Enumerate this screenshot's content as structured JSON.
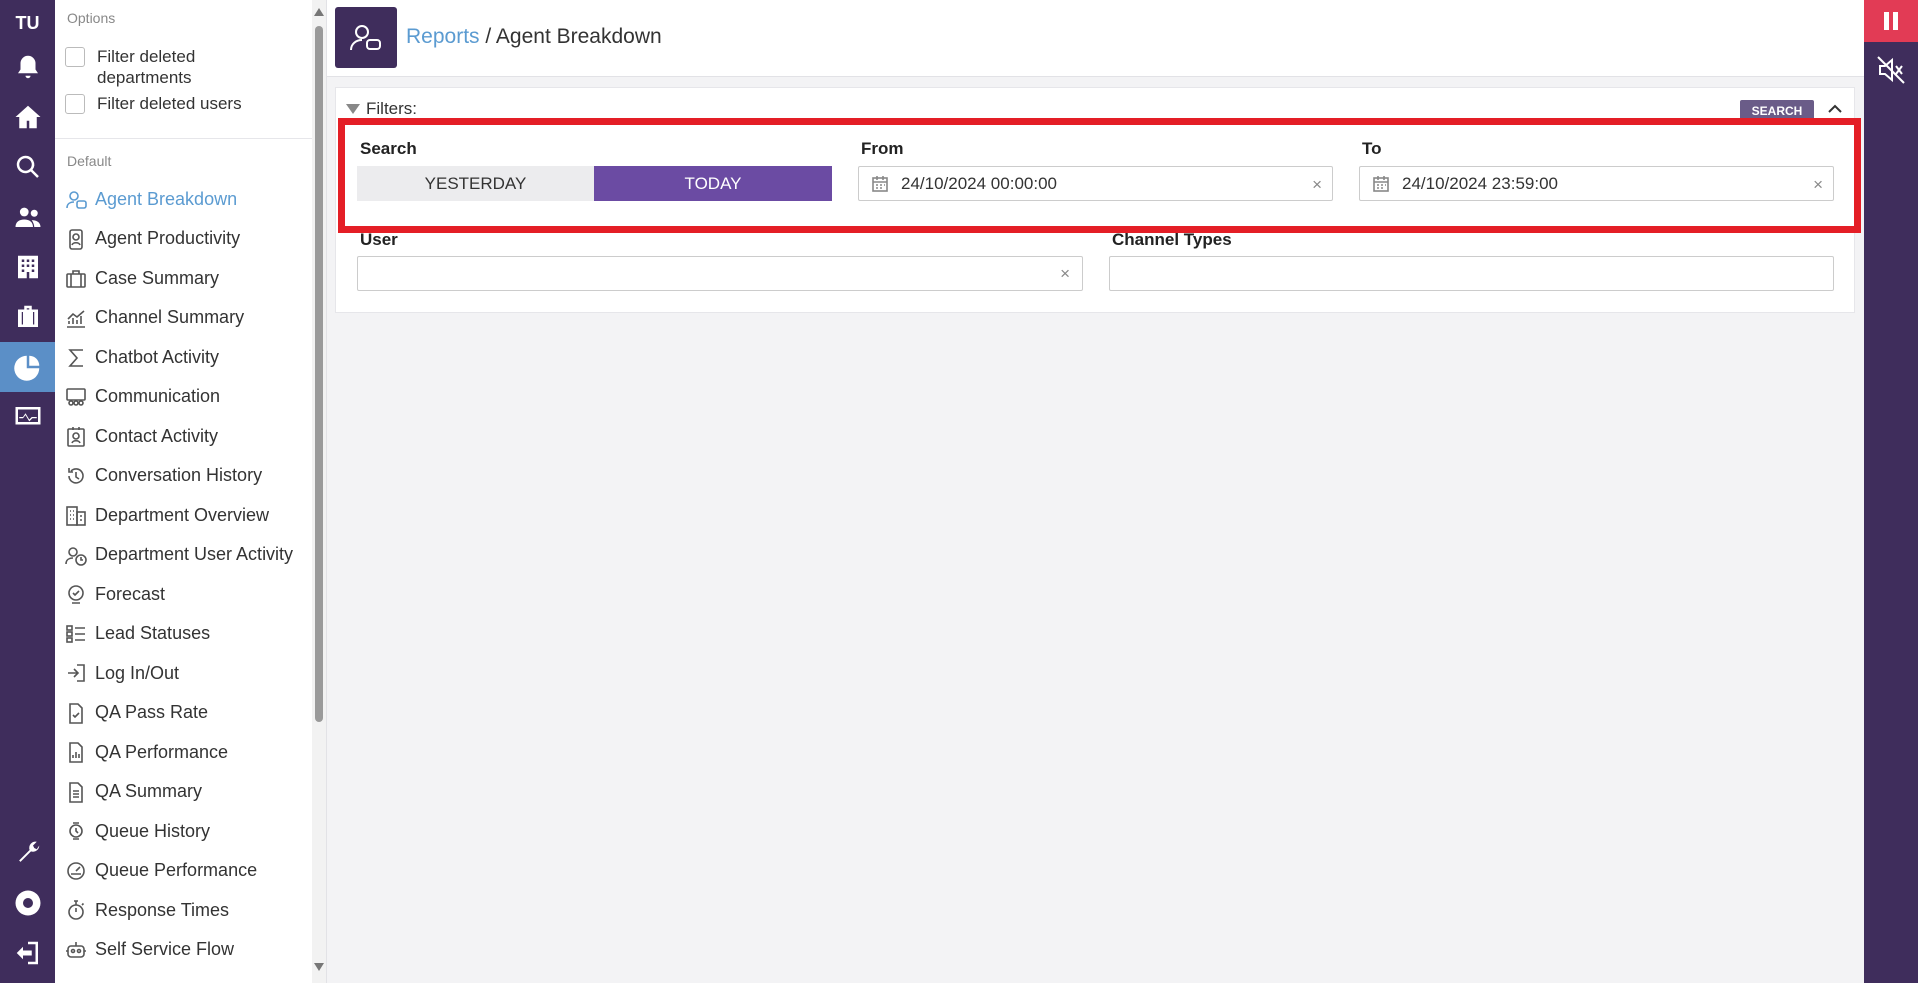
{
  "rail": {
    "brand": "TU",
    "icons": [
      "bell-icon",
      "home-icon",
      "search-icon",
      "users-icon",
      "building-icon",
      "briefcase-icon",
      "pie-chart-icon",
      "monitor-icon",
      "wrench-icon",
      "lifebuoy-icon",
      "logout-icon"
    ],
    "active": "pie-chart-icon"
  },
  "menu": {
    "options_label": "Options",
    "options": [
      {
        "label": "Filter deleted departments",
        "checked": false
      },
      {
        "label": "Filter deleted users",
        "checked": false
      }
    ],
    "default_label": "Default",
    "items": [
      {
        "label": "Agent Breakdown",
        "icon": "user-chat-icon",
        "active": true
      },
      {
        "label": "Agent Productivity",
        "icon": "badge-icon",
        "active": false
      },
      {
        "label": "Case Summary",
        "icon": "briefcase-icon",
        "active": false
      },
      {
        "label": "Channel Summary",
        "icon": "chart-icon",
        "active": false
      },
      {
        "label": "Chatbot Activity",
        "icon": "sigma-icon",
        "active": false
      },
      {
        "label": "Communication",
        "icon": "group-icon",
        "active": false
      },
      {
        "label": "Contact Activity",
        "icon": "contact-icon",
        "active": false
      },
      {
        "label": "Conversation History",
        "icon": "history-icon",
        "active": false
      },
      {
        "label": "Department Overview",
        "icon": "building-icon",
        "active": false
      },
      {
        "label": "Department User Activity",
        "icon": "user-clock-icon",
        "active": false
      },
      {
        "label": "Forecast",
        "icon": "forecast-icon",
        "active": false
      },
      {
        "label": "Lead Statuses",
        "icon": "list-icon",
        "active": false
      },
      {
        "label": "Log In/Out",
        "icon": "login-icon",
        "active": false
      },
      {
        "label": "QA Pass Rate",
        "icon": "doc-check-icon",
        "active": false
      },
      {
        "label": "QA Performance",
        "icon": "doc-chart-icon",
        "active": false
      },
      {
        "label": "QA Summary",
        "icon": "doc-list-icon",
        "active": false
      },
      {
        "label": "Queue History",
        "icon": "watch-icon",
        "active": false
      },
      {
        "label": "Queue Performance",
        "icon": "gauge-icon",
        "active": false
      },
      {
        "label": "Response Times",
        "icon": "stopwatch-icon",
        "active": false
      },
      {
        "label": "Self Service Flow",
        "icon": "robot-icon",
        "active": false
      }
    ]
  },
  "header": {
    "crumb_link": "Reports",
    "separator": "/",
    "crumb_current": "Agent Breakdown"
  },
  "filters": {
    "title": "Filters:",
    "search_button": "SEARCH",
    "search_label": "Search",
    "yesterday": "YESTERDAY",
    "today": "TODAY",
    "selected": "TODAY",
    "from_label": "From",
    "from_value": "24/10/2024 00:00:00",
    "to_label": "To",
    "to_value": "24/10/2024 23:59:00",
    "user_label": "User",
    "user_value": "",
    "channel_label": "Channel Types",
    "channel_value": "",
    "clear_glyph": "×"
  },
  "colors": {
    "rail": "#3f2d5c",
    "accent": "#6b4ba3",
    "link": "#5b9bd1",
    "highlight": "#e41e26",
    "pause": "#e23b55"
  }
}
